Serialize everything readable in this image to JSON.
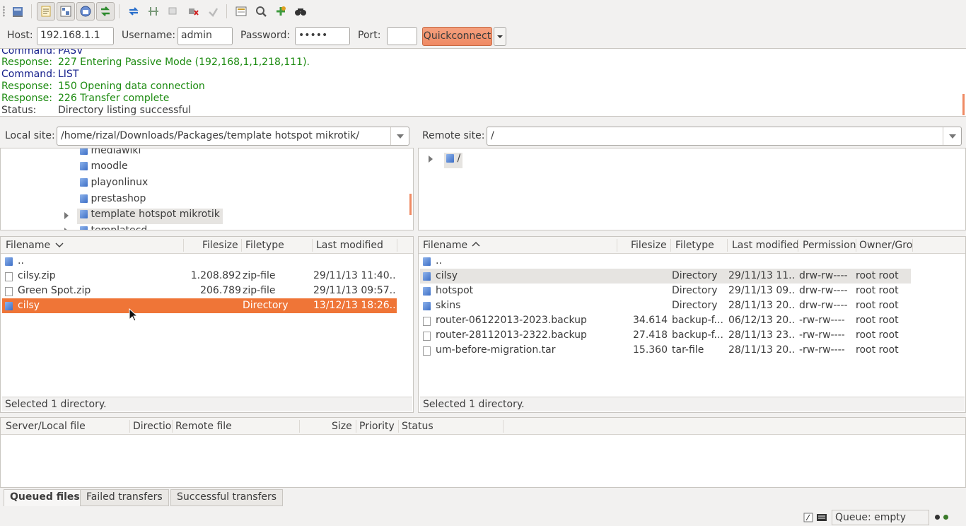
{
  "toolbar": {
    "icons": [
      "site-manager-icon",
      "message-log-icon",
      "directory-tree-icon",
      "remote-tree-icon",
      "transfer-queue-icon",
      "refresh-icon",
      "process-queue-icon",
      "cancel-operation-icon",
      "disconnect-icon",
      "reconnect-icon",
      "directory-filter-icon",
      "compare-directories-icon",
      "sync-browsing-icon",
      "search-icon"
    ]
  },
  "quickconnect": {
    "host_label": "Host:",
    "host_value": "192.168.1.1",
    "username_label": "Username:",
    "username_value": "admin",
    "password_label": "Password:",
    "password_value": "•••••",
    "port_label": "Port:",
    "port_value": "",
    "button_label": "Quickconnect"
  },
  "log": [
    {
      "type": "Command:",
      "msg": "PASV",
      "kind": "cmd"
    },
    {
      "type": "Response:",
      "msg": "227 Entering Passive Mode (192,168,1,1,218,111).",
      "kind": "resp"
    },
    {
      "type": "Command:",
      "msg": "LIST",
      "kind": "cmd"
    },
    {
      "type": "Response:",
      "msg": "150 Opening data connection",
      "kind": "resp"
    },
    {
      "type": "Response:",
      "msg": "226 Transfer complete",
      "kind": "resp"
    },
    {
      "type": "Status:",
      "msg": "Directory listing successful",
      "kind": "status"
    }
  ],
  "local": {
    "site_label": "Local site:",
    "site_path": "/home/rizal/Downloads/Packages/template hotspot mikrotik/",
    "tree": [
      "mediawiki",
      "moodle",
      "playonlinux",
      "prestashop",
      "template hotspot mikrotik",
      "templatecd"
    ],
    "headers": {
      "filename": "Filename",
      "filesize": "Filesize",
      "filetype": "Filetype",
      "modified": "Last modified"
    },
    "files": [
      {
        "name": "..",
        "size": "",
        "type": "",
        "modified": ""
      },
      {
        "name": "cilsy.zip",
        "size": "1.208.892",
        "type": "zip-file",
        "modified": "29/11/13 11:40..."
      },
      {
        "name": "Green Spot.zip",
        "size": "206.789",
        "type": "zip-file",
        "modified": "29/11/13 09:57..."
      },
      {
        "name": "cilsy",
        "size": "",
        "type": "Directory",
        "modified": "13/12/13 18:26..."
      }
    ],
    "status": "Selected 1 directory."
  },
  "remote": {
    "site_label": "Remote site:",
    "site_path": "/",
    "tree_root": "/",
    "headers": {
      "filename": "Filename",
      "filesize": "Filesize",
      "filetype": "Filetype",
      "modified": "Last modified",
      "permission": "Permission",
      "owner": "Owner/Gro"
    },
    "files": [
      {
        "name": "..",
        "size": "",
        "type": "",
        "modified": "",
        "perm": "",
        "owner": ""
      },
      {
        "name": "cilsy",
        "size": "",
        "type": "Directory",
        "modified": "29/11/13 11...",
        "perm": "drw-rw----",
        "owner": "root root"
      },
      {
        "name": "hotspot",
        "size": "",
        "type": "Directory",
        "modified": "29/11/13 09...",
        "perm": "drw-rw----",
        "owner": "root root"
      },
      {
        "name": "skins",
        "size": "",
        "type": "Directory",
        "modified": "28/11/13 20...",
        "perm": "drw-rw----",
        "owner": "root root"
      },
      {
        "name": "router-06122013-2023.backup",
        "size": "34.614",
        "type": "backup-f...",
        "modified": "06/12/13 20...",
        "perm": "-rw-rw----",
        "owner": "root root"
      },
      {
        "name": "router-28112013-2322.backup",
        "size": "27.418",
        "type": "backup-f...",
        "modified": "28/11/13 23...",
        "perm": "-rw-rw----",
        "owner": "root root"
      },
      {
        "name": "um-before-migration.tar",
        "size": "15.360",
        "type": "tar-file",
        "modified": "28/11/13 20...",
        "perm": "-rw-rw----",
        "owner": "root root"
      }
    ],
    "status": "Selected 1 directory."
  },
  "queue": {
    "headers": [
      "Server/Local file",
      "Directio",
      "Remote file",
      "Size",
      "Priority",
      "Status"
    ],
    "tabs": [
      "Queued files",
      "Failed transfers",
      "Successful transfers"
    ],
    "status": "Queue: empty"
  },
  "colors": {
    "accent": "#ef7537",
    "command": "#16208c",
    "response": "#1b8a0f"
  }
}
